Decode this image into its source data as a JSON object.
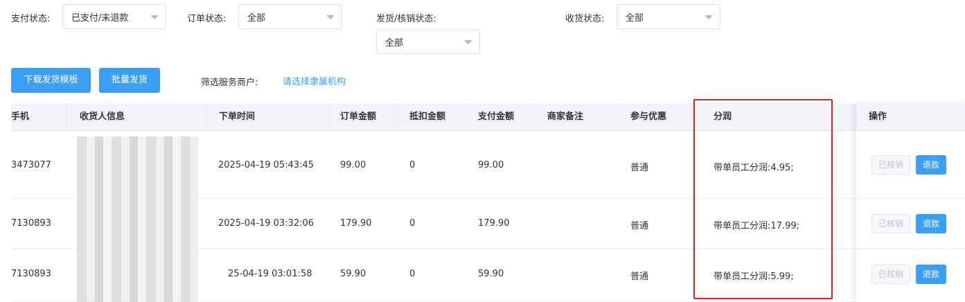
{
  "filters": {
    "pay_status": {
      "label": "支付状态:",
      "value": "已支付/未退款"
    },
    "order_status": {
      "label": "订单状态:",
      "value": "全部"
    },
    "ship_status": {
      "label": "发货/核销状态:",
      "value": "全部"
    },
    "receive_status": {
      "label": "收货状态:",
      "value": "全部"
    }
  },
  "actions": {
    "download_template": "下载发货模板",
    "batch_ship": "批量发货",
    "merchant_label": "筛选服务商户:",
    "merchant_link": "请选择隶属机构"
  },
  "table": {
    "headers": {
      "phone": "手机",
      "receiver": "收货人信息",
      "order_time": "下单时间",
      "order_amount": "订单金额",
      "deduct_amount": "抵扣金额",
      "pay_amount": "支付金额",
      "merchant_note": "商家备注",
      "promotion": "参与优惠",
      "profit_share": "分润",
      "operation": "操作"
    },
    "rows": [
      {
        "phone": "3473077",
        "order_time": "2025-04-19 05:43:45",
        "order_amount": "99.00",
        "deduct_amount": "0",
        "pay_amount": "99.00",
        "promotion": "普通",
        "profit_share": "带单员工分润:4.95;"
      },
      {
        "phone": "7130893",
        "order_time": "2025-04-19 03:32:06",
        "order_amount": "179.90",
        "deduct_amount": "0",
        "pay_amount": "179.90",
        "promotion": "普通",
        "profit_share": "带单员工分润:17.99;"
      },
      {
        "phone": "7130893",
        "order_time": "25-04-19 03:01:58",
        "order_amount": "59.90",
        "deduct_amount": "0",
        "pay_amount": "59.90",
        "promotion": "普通",
        "profit_share": "带单员工分润:5.99;"
      }
    ],
    "verified_label": "已核销",
    "refund_label": "退款"
  }
}
